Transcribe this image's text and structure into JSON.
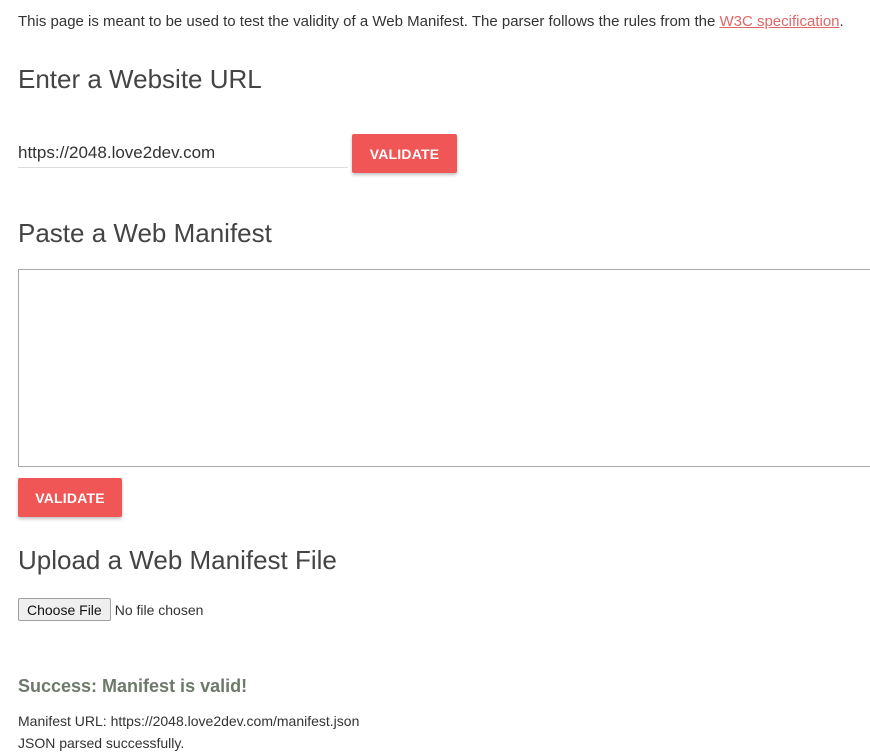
{
  "intro": {
    "text": "This page is meant to be used to test the validity of a Web Manifest. The parser follows the rules from the ",
    "link_text": "W3C specification",
    "trailing": ".",
    "link_color": "#e06666"
  },
  "url_section": {
    "heading": "Enter a Website URL",
    "input_value": "https://2048.love2dev.com",
    "button_label": "VALIDATE"
  },
  "paste_section": {
    "heading": "Paste a Web Manifest",
    "textarea_value": "",
    "button_label": "VALIDATE"
  },
  "upload_section": {
    "heading": "Upload a Web Manifest File",
    "choose_button": "Choose File",
    "status": "No file chosen"
  },
  "result": {
    "title": "Success: Manifest is valid!",
    "manifest_url": "Manifest URL: https://2048.love2dev.com/manifest.json",
    "json_status": "JSON parsed successfully."
  },
  "colors": {
    "accent": "#f05656",
    "success": "#6d7a6a"
  }
}
